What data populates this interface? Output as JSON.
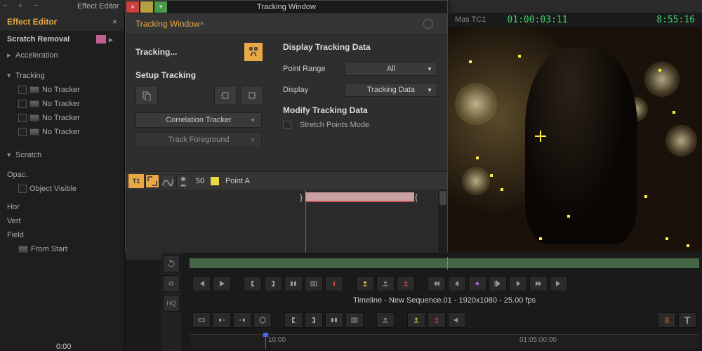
{
  "topbar": {
    "label": "Effect Editor"
  },
  "effect_panel": {
    "title": "Effect Editor",
    "scratch_removal": "Scratch Removal",
    "acceleration": "Acceleration",
    "tracking": "Tracking",
    "no_tracker": "No Tracker",
    "scratch": "Scratch",
    "opac": "Opac.",
    "object_visible": "Object Visible",
    "hor": "Hor",
    "vert": "Vert",
    "field": "Field",
    "from_start": "From Start",
    "time": "0:00"
  },
  "tracking_window": {
    "window_title": "Tracking Window",
    "header_title": "Tracking Window",
    "status": "Tracking...",
    "setup_label": "Setup Tracking",
    "tracker_type": "Correlation Tracker",
    "track_target": "Track Foreground",
    "display_section": "Display Tracking Data",
    "point_range_lbl": "Point Range",
    "point_range_val": "All",
    "display_lbl": "Display",
    "display_val": "Tracking Data",
    "modify_section": "Modify Tracking Data",
    "stretch_mode": "Stretch Points Mode",
    "tracker_row": {
      "t1": "T1",
      "value": "50",
      "point": "Point A"
    }
  },
  "timecode": {
    "label": "Mas TC1",
    "tc1": "01:00:03:11",
    "tc2": "8:55:16"
  },
  "timeline": {
    "label": "Timeline - New Sequence.01 - 1920x1080 - 25.00 fps",
    "ruler_t1": "10:00",
    "ruler_t2": "01:05:00:00"
  },
  "vtools": {
    "hq": "HQ"
  }
}
